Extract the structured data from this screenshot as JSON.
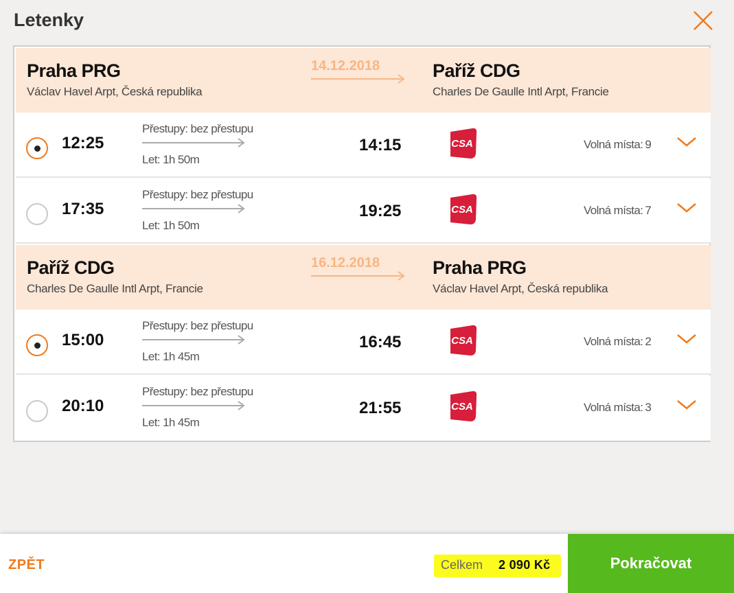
{
  "header": {
    "title": "Letenky"
  },
  "legs": [
    {
      "date": "14.12.2018",
      "from": {
        "city": "Praha PRG",
        "airport": "Václav Havel Arpt, Česká republika"
      },
      "to": {
        "city": "Paříž CDG",
        "airport": "Charles De Gaulle Intl Arpt, Francie"
      },
      "flights": [
        {
          "departure": "12:25",
          "arrival": "14:15",
          "stops": "Přestupy: bez přestupu",
          "duration": "Let: 1h 50m",
          "seats_label": "Volná místa:",
          "seats": "9",
          "selected": true,
          "airline": "CSA"
        },
        {
          "departure": "17:35",
          "arrival": "19:25",
          "stops": "Přestupy: bez přestupu",
          "duration": "Let: 1h 50m",
          "seats_label": "Volná místa:",
          "seats": "7",
          "selected": false,
          "airline": "CSA"
        }
      ]
    },
    {
      "date": "16.12.2018",
      "from": {
        "city": "Paříž CDG",
        "airport": "Charles De Gaulle Intl Arpt, Francie"
      },
      "to": {
        "city": "Praha PRG",
        "airport": "Václav Havel Arpt, Česká republika"
      },
      "flights": [
        {
          "departure": "15:00",
          "arrival": "16:45",
          "stops": "Přestupy: bez přestupu",
          "duration": "Let: 1h 45m",
          "seats_label": "Volná místa:",
          "seats": "2",
          "selected": true,
          "airline": "CSA"
        },
        {
          "departure": "20:10",
          "arrival": "21:55",
          "stops": "Přestupy: bez přestupu",
          "duration": "Let: 1h 45m",
          "seats_label": "Volná místa:",
          "seats": "3",
          "selected": false,
          "airline": "CSA"
        }
      ]
    }
  ],
  "footer": {
    "back_label": "ZPĚT",
    "total_label": "Celkem",
    "total_value": "2 090 Kč",
    "continue_label": "Pokračovat"
  },
  "colors": {
    "accent": "#f07a1c",
    "leg_header_bg": "#fde7d6",
    "date_text": "#f7b684",
    "continue_bg": "#56b91d",
    "total_highlight": "#fbfb1e",
    "airline_red": "#d71e3a"
  },
  "icons": {
    "close": "close-x-icon",
    "expand": "chevron-down-icon",
    "airline": "csa-airline-logo"
  }
}
